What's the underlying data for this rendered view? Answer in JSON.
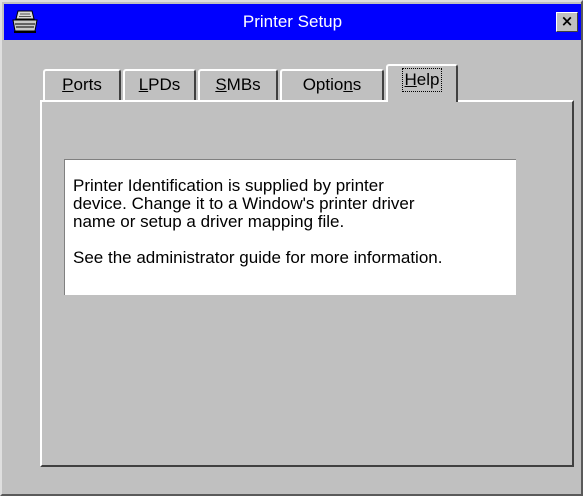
{
  "window": {
    "title": "Printer Setup",
    "close_label": "×"
  },
  "tabs": [
    {
      "prefix": "",
      "mnemonic": "P",
      "suffix": "orts",
      "active": false
    },
    {
      "prefix": "",
      "mnemonic": "L",
      "suffix": "PDs",
      "active": false
    },
    {
      "prefix": "",
      "mnemonic": "S",
      "suffix": "MBs",
      "active": false
    },
    {
      "prefix": "Optio",
      "mnemonic": "n",
      "suffix": "s",
      "active": false
    },
    {
      "prefix": "",
      "mnemonic": "H",
      "suffix": "elp",
      "active": true
    }
  ],
  "help": {
    "paragraph1": "Printer Identification is supplied by printer\ndevice.  Change it to a Window's printer driver\nname or setup a driver mapping file.",
    "paragraph2": "See the administrator guide for more information."
  },
  "colors": {
    "titlebar": "#0000ff",
    "face": "#c0c0c0",
    "text_area": "#ffffff"
  },
  "icons": {
    "app": "printer-icon",
    "close": "close-icon"
  }
}
